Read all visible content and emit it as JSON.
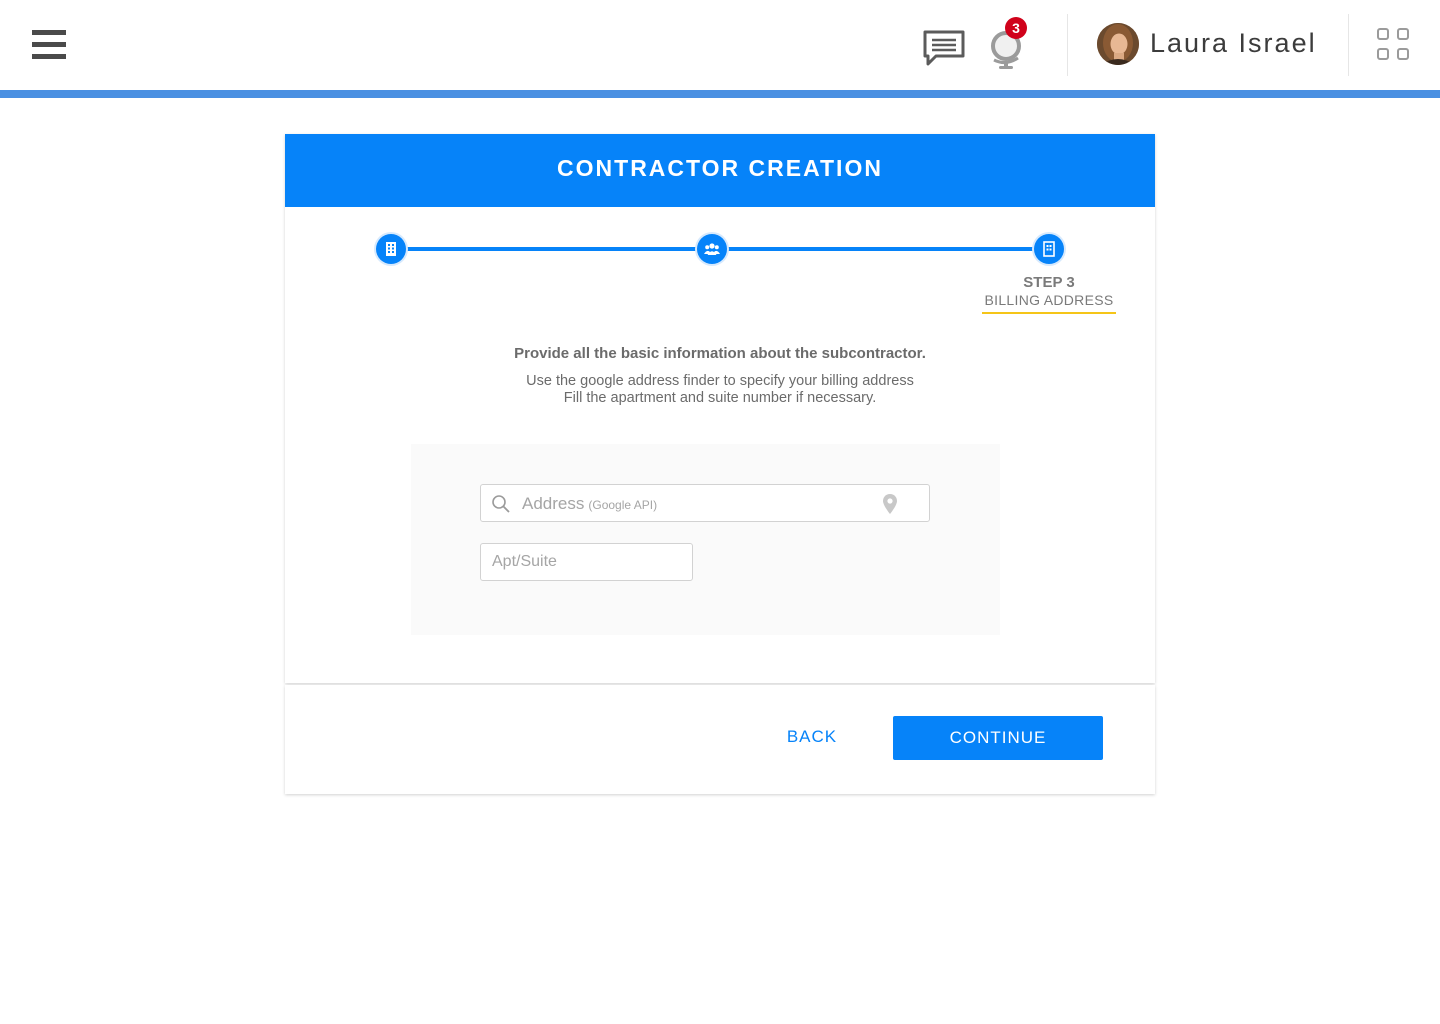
{
  "header": {
    "user_name": "Laura Israel",
    "notification_count": "3",
    "icons": [
      "hamburger-menu-icon",
      "chat-icon",
      "globe-icon",
      "avatar",
      "apps-grid-icon"
    ]
  },
  "wizard": {
    "title": "CONTRACTOR CREATION",
    "steps": [
      {
        "icon": "building-icon",
        "completed": true
      },
      {
        "icon": "users-icon",
        "completed": true
      },
      {
        "icon": "document-icon",
        "completed": true,
        "active": true
      }
    ],
    "current_step": {
      "number": "STEP 3",
      "name": "BILLING ADDRESS"
    },
    "intro_title": "Provide all the basic information about the subcontractor.",
    "intro_lines": [
      "Use the google address finder to specify your billing address",
      "Fill the apartment and suite number if necessary."
    ],
    "form": {
      "address_placeholder": "Address",
      "address_hint": "(Google API)",
      "apt_placeholder": "Apt/Suite"
    },
    "buttons": {
      "back": "BACK",
      "continue": "CONTINUE"
    }
  },
  "colors": {
    "primary": "#0683f9",
    "topbar_rule": "#4a90e2",
    "badge": "#d0021b",
    "step_underline": "#f5c518"
  }
}
